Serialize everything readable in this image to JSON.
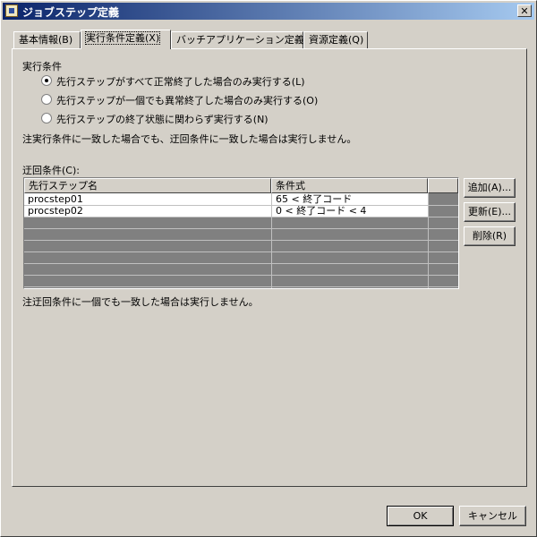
{
  "window": {
    "title": "ジョブステップ定義",
    "close_glyph": "✕"
  },
  "tabs": [
    {
      "label": "基本情報(B)"
    },
    {
      "label": "実行条件定義(X)",
      "active": true
    },
    {
      "label": "バッチアプリケーション定義(T)"
    },
    {
      "label": "資源定義(Q)"
    }
  ],
  "exec": {
    "group_label": "実行条件",
    "options": [
      {
        "label": "先行ステップがすべて正常終了した場合のみ実行する(L)",
        "checked": true
      },
      {
        "label": "先行ステップが一個でも異常終了した場合のみ実行する(O)",
        "checked": false
      },
      {
        "label": "先行ステップの終了状態に関わらず実行する(N)",
        "checked": false
      }
    ],
    "note": "注実行条件に一致した場合でも、迂回条件に一致した場合は実行しません。"
  },
  "bypass": {
    "label": "迂回条件(C):",
    "columns": [
      "先行ステップ名",
      "条件式"
    ],
    "rows": [
      {
        "step": "procstep01",
        "condition": "65 < 終了コード"
      },
      {
        "step": "procstep02",
        "condition": "0 < 終了コード < 4"
      }
    ],
    "buttons": {
      "add": "追加(A)...",
      "update": "更新(E)...",
      "delete": "削除(R)"
    },
    "note": "注迂回条件に一個でも一致した場合は実行しません。"
  },
  "footer": {
    "ok": "OK",
    "cancel": "キャンセル"
  }
}
